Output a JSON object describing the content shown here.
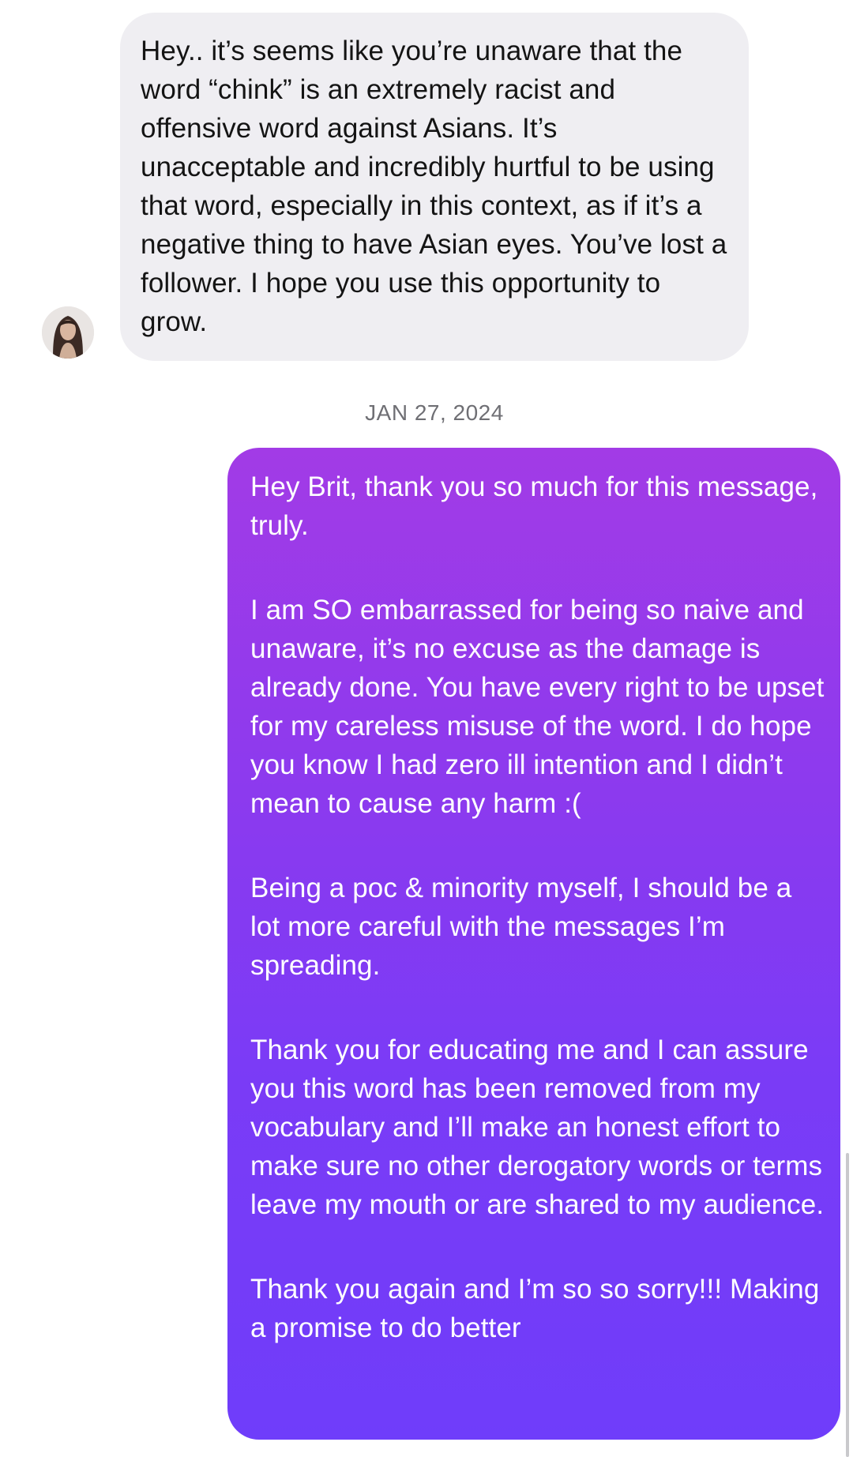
{
  "incoming_message": {
    "text": "Hey.. it’s seems like you’re unaware that the word “chink” is an extremely racist and offensive word against Asians. It’s unacceptable and incredibly hurtful to be using that word, especially in this context, as if it’s a negative thing to have Asian eyes. You’ve lost a follower. I hope you use this opportunity to grow."
  },
  "timestamp": "JAN 27, 2024",
  "outgoing_message": {
    "paragraphs": [
      "Hey Brit, thank you so much for this message, truly.",
      "I am SO embarrassed for being so naive and unaware, it’s no excuse as the damage is already done. You have every right to be upset for my careless misuse of the word. I do hope you know I had zero ill intention and I didn’t mean to cause any harm :(",
      "Being a poc & minority myself, I should be a lot more careful with the messages I’m spreading.",
      "Thank you for educating me and I can assure you this word has been removed from my vocabulary and I’ll make an honest effort to make sure no other derogatory words or terms leave my mouth or are shared to my audience.",
      "Thank you again and I’m so so sorry!!! Making a promise to do better"
    ]
  },
  "colors": {
    "incoming_bubble": "#efeef2",
    "outgoing_gradient_top": "#a23be6",
    "outgoing_gradient_bottom": "#6f3dfa",
    "timestamp_text": "#6f6f74"
  }
}
